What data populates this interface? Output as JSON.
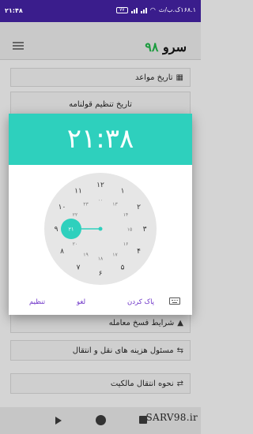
{
  "status_bar": {
    "time": "۲۱:۴۸",
    "battery": "۷۷",
    "network_speed": "۱۶۸.۱ک.ب/ث"
  },
  "app": {
    "logo_word": "سرو",
    "logo_number": "۹۸",
    "menu_icon": "hamburger-icon"
  },
  "list": {
    "items": [
      {
        "label": "تاریخ مواعد",
        "icon": "calendar-icon"
      },
      {
        "label": "تاریخ تنظیم قولنامه",
        "icon": "none"
      },
      {
        "label": "شرایط فسخ معامله",
        "icon": "warning-icon"
      },
      {
        "label": "مسئول هزینه های نقل و انتقال",
        "icon": "handshake-icon"
      },
      {
        "label": "نحوه انتقال مالکیت",
        "icon": "transfer-icon"
      }
    ]
  },
  "time_picker": {
    "display_time": "۲۱:۳۸",
    "selected_hour": "۲۱",
    "outer_hours": [
      "۱۲",
      "۱",
      "۲",
      "۳",
      "۴",
      "۵",
      "۶",
      "۷",
      "۸",
      "۹",
      "۱۰",
      "۱۱"
    ],
    "inner_hours": [
      "۰۰",
      "۱۳",
      "۱۴",
      "۱۵",
      "۱۶",
      "۱۷",
      "۱۸",
      "۱۹",
      "۲۰",
      "۲۱",
      "۲۲",
      "۲۳"
    ],
    "accent_color": "#2ed0bd",
    "actions": {
      "keyboard_icon": "keyboard-icon",
      "clear": "پاک کردن",
      "cancel": "لغو",
      "set": "تنظیم"
    }
  },
  "watermark": "SARV98.ir"
}
